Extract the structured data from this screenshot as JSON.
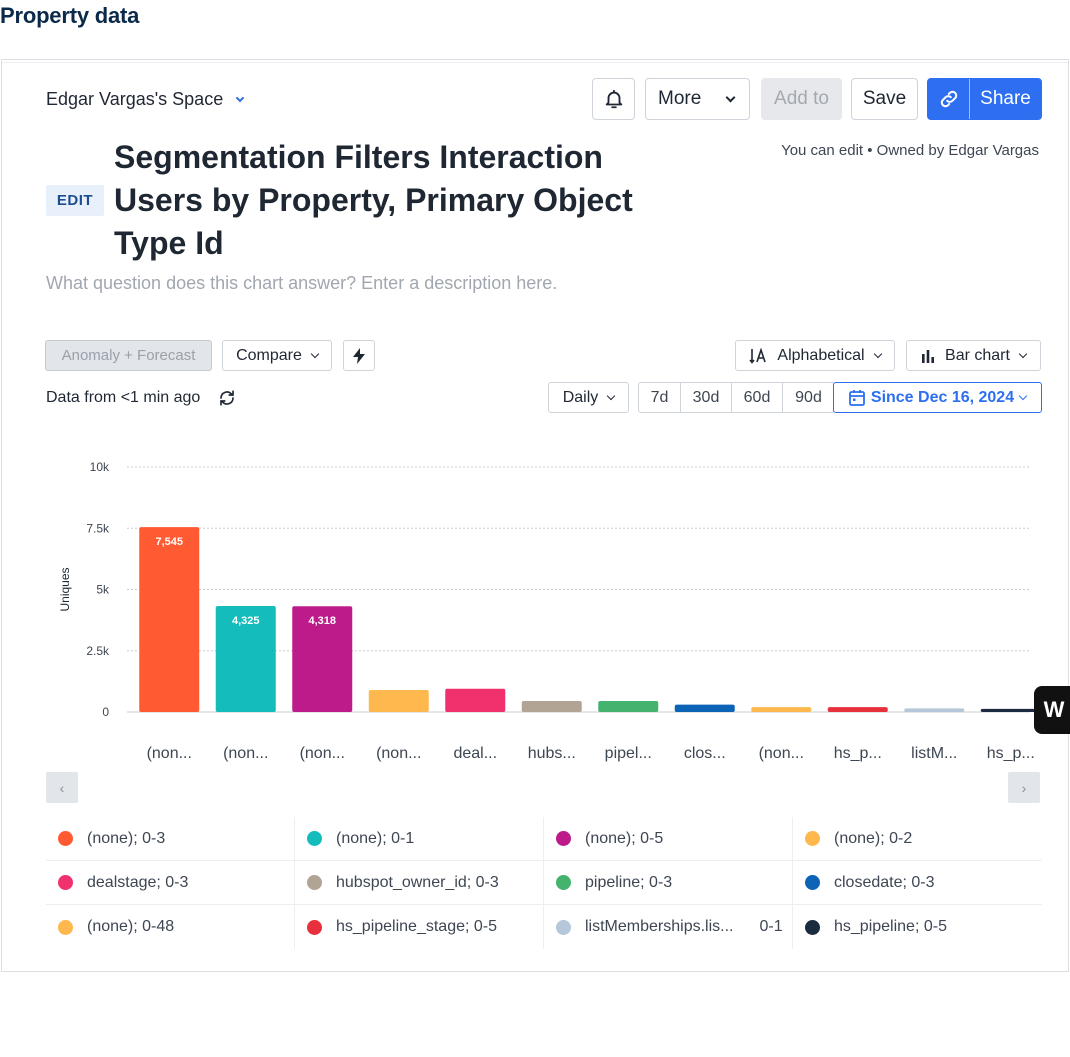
{
  "page": {
    "heading": "Property data"
  },
  "header": {
    "space_name": "Edgar Vargas's Space",
    "more_label": "More",
    "add_to_label": "Add to",
    "save_label": "Save",
    "share_label": "Share",
    "owner_text": "You can edit • Owned by Edgar Vargas"
  },
  "chart_meta": {
    "edit_badge": "EDIT",
    "title": "Segmentation Filters Interaction Users by Property, Primary Object Type Id",
    "description_placeholder": "What question does this chart answer? Enter a description here."
  },
  "controls": {
    "anomaly_label": "Anomaly + Forecast",
    "compare_label": "Compare",
    "sort_label": "Alphabetical",
    "chart_type_label": "Bar chart",
    "interval_label": "Daily",
    "ranges": [
      "7d",
      "30d",
      "60d",
      "90d"
    ],
    "since_label": "Since Dec 16, 2024",
    "data_from": "Data from <1 min ago"
  },
  "colors": {
    "accent": "#2d6ff0",
    "series": [
      "#ff5a32",
      "#14bcbc",
      "#bd1b89",
      "#ffb84d",
      "#f0316e",
      "#b1a494",
      "#44b36e",
      "#0d64b7",
      "#ffb84d",
      "#e8303c",
      "#b5c7d8",
      "#1b2b40"
    ]
  },
  "legend": [
    {
      "label": "(none); 0-3"
    },
    {
      "label": "(none); 0-1"
    },
    {
      "label": "(none); 0-5"
    },
    {
      "label": "(none); 0-2"
    },
    {
      "label": "dealstage; 0-3"
    },
    {
      "label": "hubspot_owner_id; 0-3"
    },
    {
      "label": "pipeline; 0-3"
    },
    {
      "label": "closedate; 0-3"
    },
    {
      "label": "(none); 0-48"
    },
    {
      "label": "hs_pipeline_stage; 0-5"
    },
    {
      "label": "listMemberships.lis...",
      "value": "0-1"
    },
    {
      "label": "hs_pipeline; 0-5"
    }
  ],
  "side_badge": "W",
  "chart_data": {
    "type": "bar",
    "ylabel": "Uniques",
    "xlabel": "",
    "ylim": [
      0,
      10000
    ],
    "yticks": [
      0,
      2500,
      5000,
      7500,
      10000
    ],
    "ytick_labels": [
      "0",
      "2.5k",
      "5k",
      "7.5k",
      "10k"
    ],
    "grid": true,
    "categories": [
      "(non...",
      "(non...",
      "(non...",
      "(non...",
      "deal...",
      "hubs...",
      "pipel...",
      "clos...",
      "(non...",
      "hs_p...",
      "listM...",
      "hs_p..."
    ],
    "values": [
      7545,
      4325,
      4318,
      900,
      950,
      450,
      450,
      300,
      200,
      200,
      150,
      130
    ],
    "data_labels": [
      "7,545",
      "4,325",
      "4,318",
      "",
      "",
      "",
      "",
      "",
      "",
      "",
      "",
      ""
    ]
  }
}
